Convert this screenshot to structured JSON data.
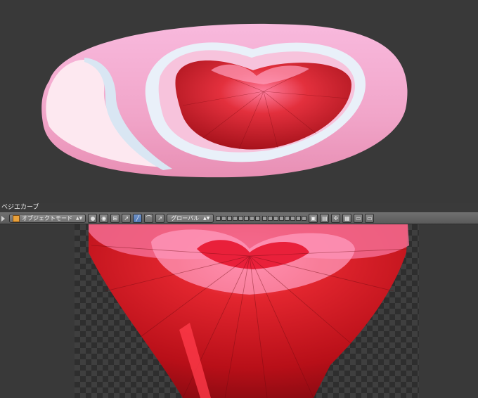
{
  "header": {
    "object_name": "ベジエカーブ",
    "mode": "オブジェクトモード",
    "orientation": "グローバル"
  },
  "icons": {
    "collapse": "triangle-right-icon",
    "mode_cube": "cube-icon",
    "shading": "shading-sphere-icon",
    "pivot": "pivot-icon",
    "manipulator": "manipulator-icon",
    "translate": "translate-arrow-icon",
    "rotate": "rotate-icon",
    "scale": "scale-icon",
    "layers": "layer-grid-icon",
    "lock": "lock-icon",
    "snap": "snap-magnet-icon",
    "render": "render-camera-icon"
  },
  "colors": {
    "pink": "#f6a6cf",
    "heart_red": "#d1161f",
    "ui_bg": "#3a3a3a",
    "header": "#676767"
  }
}
